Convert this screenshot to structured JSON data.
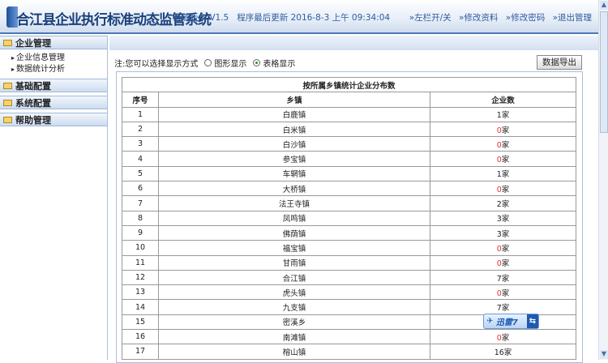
{
  "header": {
    "title": "合江县企业执行标准动态监管系统",
    "version": "系统版本 V1.5",
    "updated": "程序最后更新 2016-8-3 上午 09:34:04",
    "links": [
      "»左栏开/关",
      "»修改资料",
      "»修改密码",
      "»退出管理"
    ]
  },
  "sidebar": {
    "menus": [
      {
        "label": "企业管理",
        "items": [
          "企业信息管理",
          "数据统计分析"
        ]
      },
      {
        "label": "基础配置"
      },
      {
        "label": "系统配置"
      },
      {
        "label": "帮助管理"
      }
    ]
  },
  "main": {
    "note": "注:您可以选择显示方式",
    "radio_graph": "图形显示",
    "radio_table": "表格显示",
    "selected": "表格显示",
    "export_label": "数据导出",
    "table": {
      "caption": "按所属乡镇统计企业分布数",
      "headers": [
        "序号",
        "乡镇",
        "企业数"
      ],
      "unit": "家",
      "rows": [
        [
          "1",
          "白鹿镇",
          "1"
        ],
        [
          "2",
          "白米镇",
          "0"
        ],
        [
          "3",
          "白沙镇",
          "0"
        ],
        [
          "4",
          "参宝镇",
          "0"
        ],
        [
          "5",
          "车辋镇",
          "1"
        ],
        [
          "6",
          "大桥镇",
          "0"
        ],
        [
          "7",
          "法王寺镇",
          "2"
        ],
        [
          "8",
          "凤鸣镇",
          "3"
        ],
        [
          "9",
          "佛荫镇",
          "3"
        ],
        [
          "10",
          "福宝镇",
          "0"
        ],
        [
          "11",
          "甘雨镇",
          "0"
        ],
        [
          "12",
          "合江镇",
          "7"
        ],
        [
          "13",
          "虎头镇",
          "0"
        ],
        [
          "14",
          "九支镇",
          "7"
        ],
        [
          "15",
          "密溪乡",
          ""
        ],
        [
          "16",
          "南滩镇",
          "0"
        ],
        [
          "17",
          "榕山镇",
          "16"
        ]
      ]
    }
  },
  "overlay": {
    "label": "迅雷7",
    "switch": "⇆"
  },
  "colors": {
    "zero": "#e03030",
    "accent": "#1a3f7a"
  }
}
